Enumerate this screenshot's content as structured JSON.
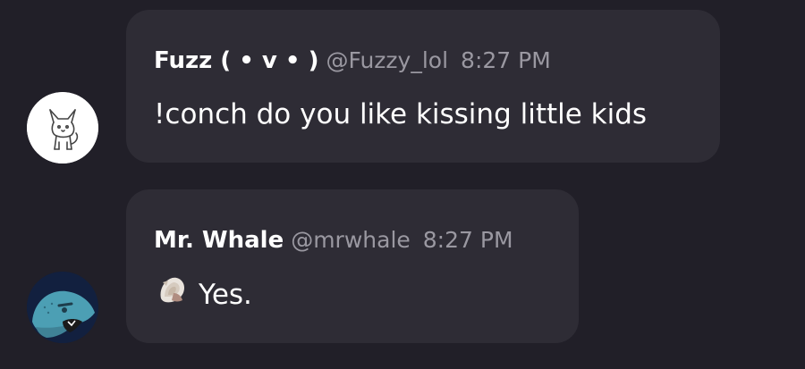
{
  "messages": [
    {
      "name": "Fuzz ( • v • )",
      "handle": "@Fuzzy_lol",
      "time": "8:27 PM",
      "text": "!conch do you like kissing little kids"
    },
    {
      "name": "Mr. Whale",
      "handle": "@mrwhale",
      "time": "8:27 PM",
      "text": "Yes.",
      "prefix_icon": "conch-shell-icon"
    }
  ],
  "colors": {
    "background": "#211f28",
    "bubble": "#2e2c35",
    "name": "#ffffff",
    "muted": "#9a98a1"
  }
}
